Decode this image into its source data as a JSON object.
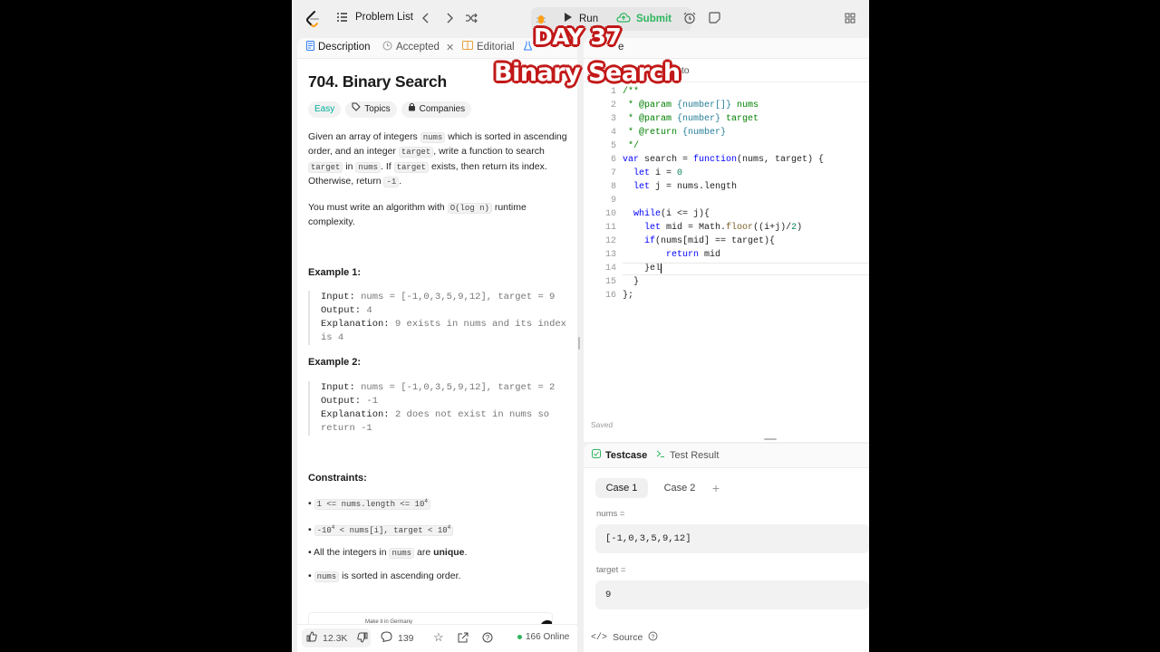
{
  "nav": {
    "problem_list": "Problem List",
    "run": "Run",
    "submit": "Submit",
    "colors": {
      "submit": "#2db55d",
      "logo": "#ffa116"
    }
  },
  "tabs": {
    "description": "Description",
    "accepted": "Accepted",
    "editorial": "Editorial",
    "code_partial": "e",
    "auto": "Auto"
  },
  "problem": {
    "title": "704. Binary Search",
    "difficulty": "Easy",
    "topics": "Topics",
    "companies": "Companies",
    "p1": {
      "a": "Given an array of integers ",
      "c1": "nums",
      "b": " which is sorted in ascending order, and an integer ",
      "c2": "target",
      "c": ", write a function to search ",
      "c3": "target",
      "d": " in ",
      "c4": "nums",
      "e": ". If ",
      "c5": "target",
      "f": " exists, then return its index. Otherwise, return ",
      "c6": "-1",
      "g": "."
    },
    "p2": {
      "a": "You must write an algorithm with ",
      "c1": "O(log n)",
      "b": " runtime complexity."
    },
    "example1": {
      "heading": "Example 1:",
      "input_label": "Input:",
      "input": "nums = [-1,0,3,5,9,12], target = 9",
      "output_label": "Output:",
      "output": "4",
      "expl_label": "Explanation:",
      "expl": "9 exists in nums and its index is 4"
    },
    "example2": {
      "heading": "Example 2:",
      "input_label": "Input:",
      "input": "nums = [-1,0,3,5,9,12], target = 2",
      "output_label": "Output:",
      "output": "-1",
      "expl_label": "Explanation:",
      "expl": "2 does not exist in nums so return -1"
    },
    "constraints": {
      "heading": "Constraints:",
      "c1": "1 <= nums.length <= 10",
      "c1_sup": "4",
      "c2a": "-10",
      "c2a_sup": "4",
      "c2b": " < nums[i], target < 10",
      "c2b_sup": "4",
      "c3a": "All the integers in ",
      "c3code": "nums",
      "c3b": " are ",
      "c3strong": "unique",
      "c3c": ".",
      "c4code": "nums",
      "c4b": " is sorted in ascending order."
    },
    "ad_text": "Make it in Germany"
  },
  "footer": {
    "likes": "12.3K",
    "comments": "139",
    "online": "166 Online"
  },
  "editor": {
    "line_numbers": [
      "1",
      "2",
      "3",
      "4",
      "5",
      "6",
      "7",
      "8",
      "9",
      "10",
      "11",
      "12",
      "13",
      "14",
      "15",
      "16"
    ],
    "saved": "Saved"
  },
  "testpanel": {
    "testcase_tab": "Testcase",
    "result_tab": "Test Result",
    "case1": "Case 1",
    "case2": "Case 2",
    "nums_label": "nums =",
    "nums_value": "[-1,0,3,5,9,12]",
    "target_label": "target =",
    "target_value": "9",
    "source": "Source"
  },
  "overlay": {
    "day": "DAY 37",
    "title": "Binary Search",
    "color": "#c21818"
  }
}
